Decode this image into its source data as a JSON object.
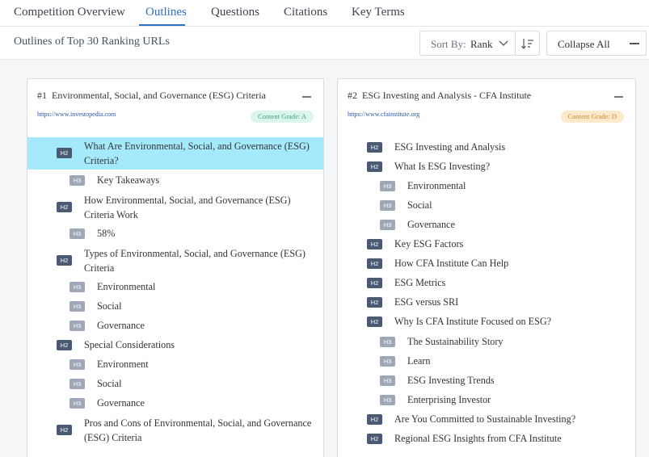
{
  "tabs": [
    {
      "label": "Competition Overview",
      "active": false
    },
    {
      "label": "Outlines",
      "active": true
    },
    {
      "label": "Questions",
      "active": false
    },
    {
      "label": "Citations",
      "active": false
    },
    {
      "label": "Key Terms",
      "active": false
    }
  ],
  "toolbar": {
    "title": "Outlines of Top 30 Ranking URLs",
    "sort_label": "Sort By:",
    "sort_value": "Rank",
    "collapse_label": "Collapse All"
  },
  "cards": [
    {
      "rank": "#1",
      "title": "Environmental, Social, and Governance (ESG) Criteria",
      "url": "https://www.investopedia.com",
      "grade": "Content Grade: A",
      "items": [
        {
          "level": "H2",
          "text": "What Are Environmental, Social, and Governance (ESG) Criteria?",
          "highlight": true
        },
        {
          "level": "H3",
          "text": "Key Takeaways"
        },
        {
          "level": "H2",
          "text": "How Environmental, Social, and Governance (ESG) Criteria Work"
        },
        {
          "level": "H3",
          "text": "58%"
        },
        {
          "level": "H2",
          "text": "Types of Environmental, Social, and Governance (ESG) Criteria"
        },
        {
          "level": "H3",
          "text": "Environmental"
        },
        {
          "level": "H3",
          "text": "Social"
        },
        {
          "level": "H3",
          "text": "Governance"
        },
        {
          "level": "H2",
          "text": "Special Considerations"
        },
        {
          "level": "H3",
          "text": "Environment"
        },
        {
          "level": "H3",
          "text": "Social"
        },
        {
          "level": "H3",
          "text": "Governance"
        },
        {
          "level": "H2",
          "text": "Pros and Cons of Environmental, Social, and Governance (ESG) Criteria"
        }
      ]
    },
    {
      "rank": "#2",
      "title": "ESG Investing and Analysis - CFA Institute",
      "url": "https://www.cfainstitute.org",
      "grade": "Content Grade: D",
      "items": [
        {
          "level": "H2",
          "text": "ESG Investing and Analysis"
        },
        {
          "level": "H2",
          "text": "What Is ESG Investing?"
        },
        {
          "level": "H3",
          "text": "Environmental"
        },
        {
          "level": "H3",
          "text": "Social"
        },
        {
          "level": "H3",
          "text": "Governance"
        },
        {
          "level": "H2",
          "text": "Key ESG Factors"
        },
        {
          "level": "H2",
          "text": "How CFA Institute Can Help"
        },
        {
          "level": "H2",
          "text": "ESG Metrics"
        },
        {
          "level": "H2",
          "text": "ESG versus SRI"
        },
        {
          "level": "H2",
          "text": "Why Is CFA Institute Focused on ESG?"
        },
        {
          "level": "H3",
          "text": "The Sustainability Story"
        },
        {
          "level": "H3",
          "text": "Learn"
        },
        {
          "level": "H3",
          "text": "ESG Investing Trends"
        },
        {
          "level": "H3",
          "text": "Enterprising Investor"
        },
        {
          "level": "H2",
          "text": "Are You Committed to Sustainable Investing?"
        },
        {
          "level": "H2",
          "text": "Regional ESG Insights from CFA Institute"
        }
      ]
    }
  ]
}
